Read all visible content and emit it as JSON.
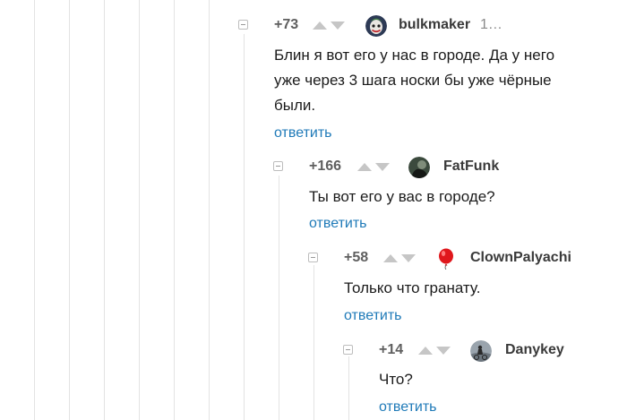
{
  "comments": [
    {
      "rating": "+73",
      "author": "bulkmaker",
      "time": "1…",
      "avatar_icon": "joker-face-avatar",
      "text_lines": [
        "Блин я вот его у нас в городе. Да у него",
        "уже через 3 шага носки бы уже чёрные",
        "были."
      ],
      "reply": "ответить"
    },
    {
      "rating": "+166",
      "author": "FatFunk",
      "avatar_icon": "dark-figure-avatar",
      "text_lines": [
        "Ты вот его у вас в городе?"
      ],
      "reply": "ответить"
    },
    {
      "rating": "+58",
      "author": "ClownPalyachi",
      "avatar_icon": "red-balloon-avatar",
      "text_lines": [
        "Только что гранату."
      ],
      "reply": "ответить"
    },
    {
      "rating": "+14",
      "author": "Danykey",
      "avatar_icon": "cyclist-avatar",
      "text_lines": [
        "Что?"
      ],
      "reply": "ответить"
    }
  ],
  "colors": {
    "rail": "#e3e3e3",
    "reply_link": "#1f7ab8",
    "vote_arrow": "#c6c6c6",
    "rating": "#5f5f5f"
  }
}
